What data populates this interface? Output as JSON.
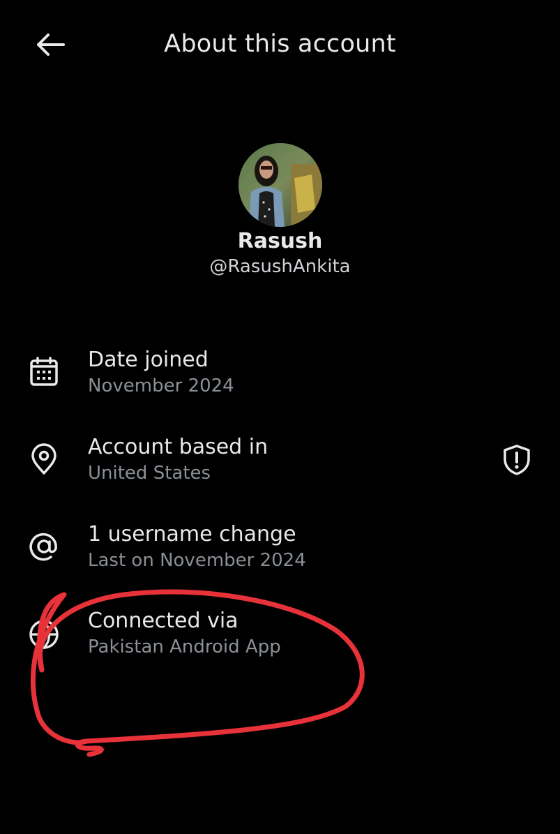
{
  "header": {
    "title": "About this account",
    "back_icon": "arrow-left-icon"
  },
  "profile": {
    "display_name": "Rasush",
    "handle": "@RasushAnkita",
    "avatar": "avatar-photo"
  },
  "rows": [
    {
      "icon": "calendar-icon",
      "label": "Date joined",
      "value": "November 2024"
    },
    {
      "icon": "location-pin-icon",
      "label": "Account based in",
      "value": "United States",
      "trailing_icon": "shield-alert-icon"
    },
    {
      "icon": "at-sign-icon",
      "label": "1 username change",
      "value": "Last on November 2024"
    },
    {
      "icon": "globe-icon",
      "label": "Connected via",
      "value": "Pakistan Android App"
    }
  ],
  "colors": {
    "background": "#000000",
    "primary_text": "#e7e9ea",
    "secondary_text": "#8b9096",
    "annotation": "#e8323a"
  }
}
